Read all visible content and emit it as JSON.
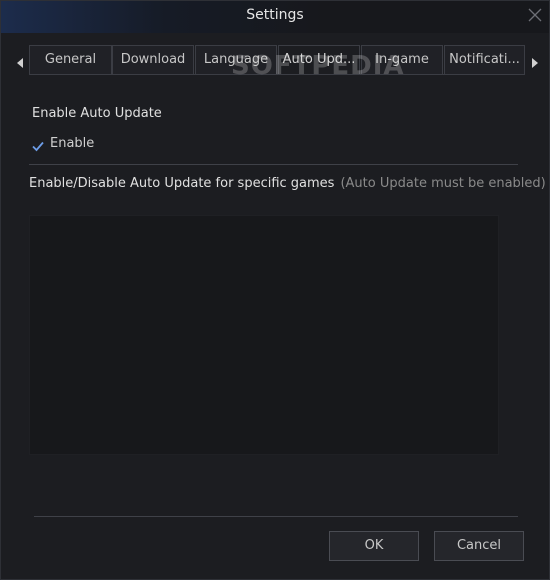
{
  "window": {
    "title": "Settings"
  },
  "tabs": [
    {
      "label": "General",
      "active": false
    },
    {
      "label": "Download",
      "active": false
    },
    {
      "label": "Language",
      "active": false
    },
    {
      "label": "Auto Upd...",
      "active": true
    },
    {
      "label": "In-game",
      "active": false
    },
    {
      "label": "Notificati...",
      "active": false
    }
  ],
  "watermark": "SOFTPEDIA",
  "auto_update": {
    "section_title": "Enable Auto Update",
    "enable_label": "Enable",
    "enable_checked": true
  },
  "games": {
    "label": "Enable/Disable Auto Update for specific games",
    "note": "(Auto Update must be enabled)",
    "items": []
  },
  "buttons": {
    "ok": "OK",
    "cancel": "Cancel"
  },
  "icons": {
    "close": "close-icon",
    "tab_left": "arrow-left-icon",
    "tab_right": "arrow-right-icon",
    "checkbox": "checkmark-icon"
  },
  "colors": {
    "check_accent": "#6d9de8",
    "background": "#1c1d21"
  }
}
